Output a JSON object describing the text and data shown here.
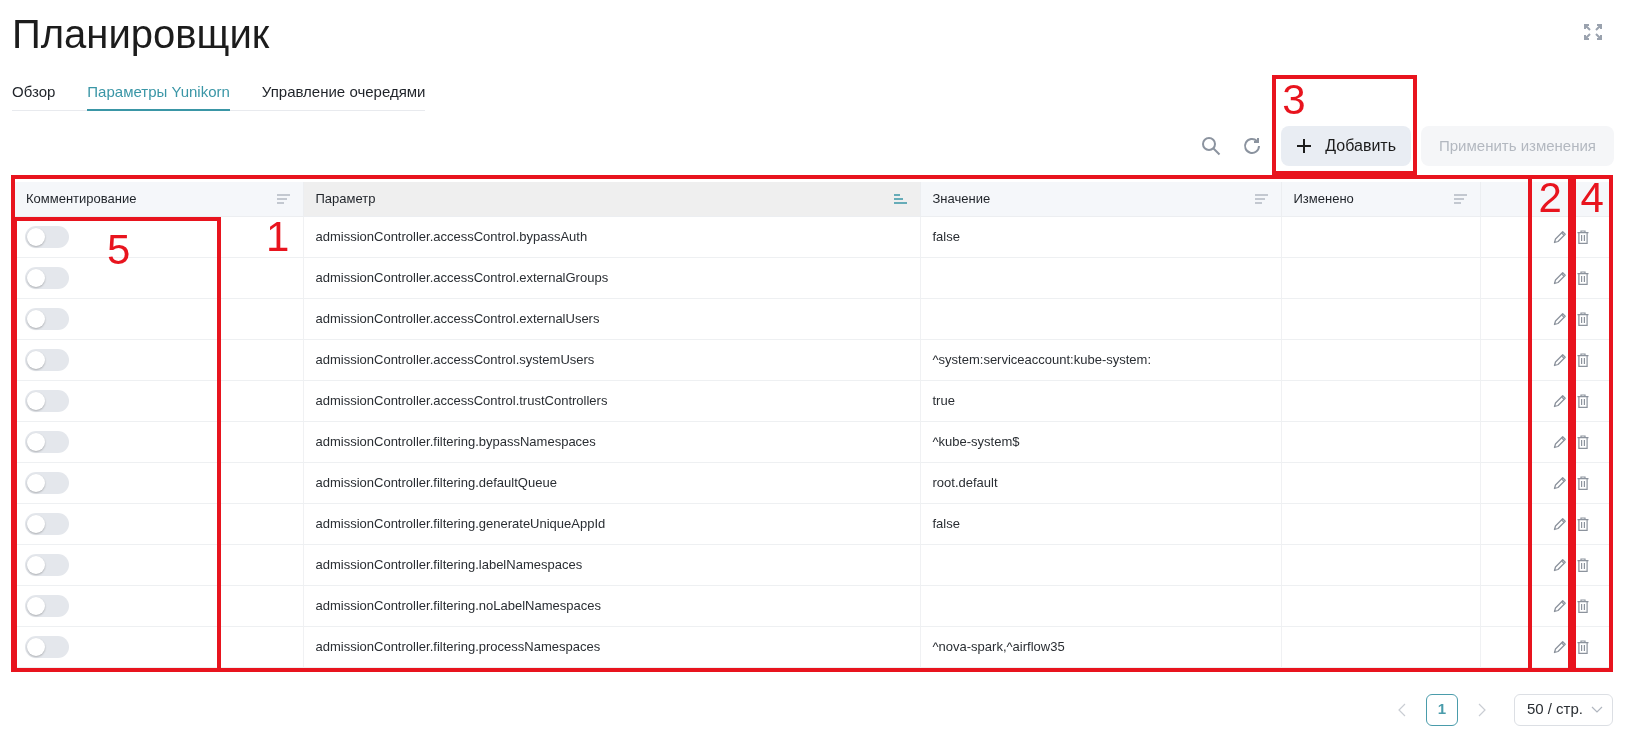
{
  "page": {
    "title": "Планировщик"
  },
  "tabs": [
    {
      "label": "Обзор",
      "selected": false
    },
    {
      "label": "Параметры Yunikorn",
      "selected": true
    },
    {
      "label": "Управление очередями",
      "selected": false
    }
  ],
  "toolbar": {
    "add_button": {
      "label": "Добавить",
      "annotation": "3"
    },
    "apply_button": {
      "label": "Применить изменения",
      "disabled": true
    }
  },
  "table": {
    "annotation": "1",
    "columns": [
      {
        "label": "Комментирование",
        "sorted": false,
        "annotation": "5"
      },
      {
        "label": "Параметр",
        "sorted": true
      },
      {
        "label": "Значение",
        "sorted": false
      },
      {
        "label": "Изменено",
        "sorted": false
      }
    ],
    "row_actions": [
      {
        "kind": "edit",
        "annotation": "2"
      },
      {
        "kind": "delete",
        "annotation": "4"
      }
    ],
    "rows": [
      {
        "commented": false,
        "parameter": "admissionController.accessControl.bypassAuth",
        "value": "false"
      },
      {
        "commented": false,
        "parameter": "admissionController.accessControl.externalGroups"
      },
      {
        "commented": false,
        "parameter": "admissionController.accessControl.externalUsers"
      },
      {
        "commented": false,
        "parameter": "admissionController.accessControl.systemUsers",
        "value": "^system:serviceaccount:kube-system:"
      },
      {
        "commented": false,
        "parameter": "admissionController.accessControl.trustControllers",
        "value": "true"
      },
      {
        "commented": false,
        "parameter": "admissionController.filtering.bypassNamespaces",
        "value": "^kube-system$"
      },
      {
        "commented": false,
        "parameter": "admissionController.filtering.defaultQueue",
        "value": "root.default"
      },
      {
        "commented": false,
        "parameter": "admissionController.filtering.generateUniqueAppId",
        "value": "false"
      },
      {
        "commented": false,
        "parameter": "admissionController.filtering.labelNamespaces"
      },
      {
        "commented": false,
        "parameter": "admissionController.filtering.noLabelNamespaces"
      },
      {
        "commented": false,
        "parameter": "admissionController.filtering.processNamespaces",
        "value": "^nova-spark,^airflow35"
      }
    ]
  },
  "pagination": {
    "previous_disabled": true,
    "pages": [
      {
        "label": "1",
        "selected": true
      }
    ],
    "next_disabled": true,
    "page_size": "50 / стр."
  }
}
